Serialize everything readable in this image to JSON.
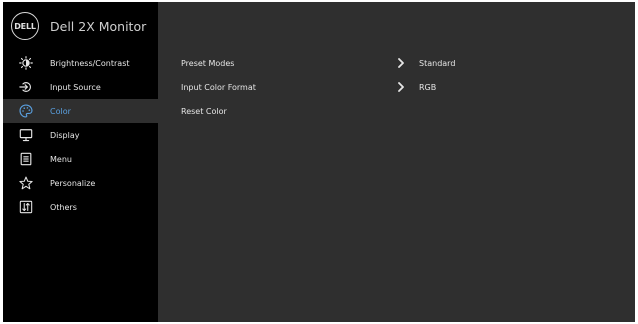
{
  "header": {
    "logo_text": "DELL",
    "title": "Dell 2X Monitor"
  },
  "sidebar": {
    "items": [
      {
        "label": "Brightness/Contrast",
        "icon": "brightness-icon"
      },
      {
        "label": "Input Source",
        "icon": "input-source-icon"
      },
      {
        "label": "Color",
        "icon": "palette-icon",
        "active": true
      },
      {
        "label": "Display",
        "icon": "display-icon"
      },
      {
        "label": "Menu",
        "icon": "menu-icon"
      },
      {
        "label": "Personalize",
        "icon": "star-icon"
      },
      {
        "label": "Others",
        "icon": "others-icon"
      }
    ]
  },
  "content": {
    "rows": [
      {
        "label": "Preset Modes",
        "value": "Standard",
        "has_submenu": true
      },
      {
        "label": "Input Color Format",
        "value": "RGB",
        "has_submenu": true
      },
      {
        "label": "Reset Color",
        "value": "",
        "has_submenu": false
      }
    ]
  },
  "colors": {
    "panel_background": "#2f2f2f",
    "sidebar_background": "#000000",
    "active_text": "#5aa0e0",
    "text": "#e6e6e6"
  }
}
